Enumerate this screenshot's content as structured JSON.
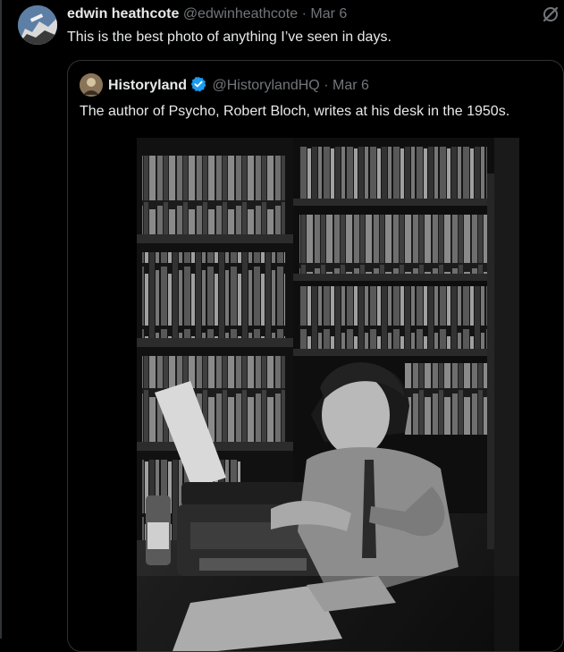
{
  "tweet": {
    "display_name": "edwin heathcote",
    "handle": "@edwinheathcote",
    "separator": "·",
    "date": "Mar 6",
    "text": "This is the best photo of anything I’ve seen in days."
  },
  "quote": {
    "display_name": "Historyland",
    "handle": "@HistorylandHQ",
    "separator": "·",
    "date": "Mar 6",
    "text": "The author of Psycho, Robert Bloch, writes at his desk in the 1950s.",
    "verified_color": "#1d9bf0"
  },
  "icons": {
    "grok": "grok-icon",
    "verified": "verified-badge-icon"
  }
}
